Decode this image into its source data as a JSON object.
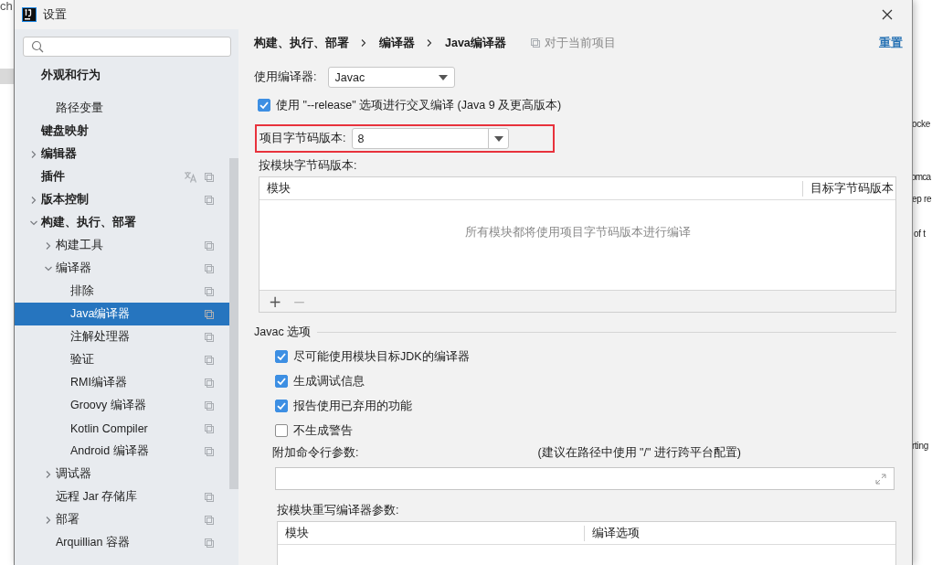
{
  "background_page": {
    "texts": [
      "ch",
      "ocke",
      "omca",
      "ep re",
      "of t",
      "rting"
    ]
  },
  "window": {
    "title": "设置"
  },
  "sidebar": {
    "items": [
      {
        "label": "外观和行为",
        "selected": false,
        "scope_icon": false,
        "children": [
          {
            "label": "路径变量",
            "selected": false,
            "scope_icon": false
          }
        ]
      },
      {
        "label": "键盘映射",
        "selected": false,
        "scope_icon": false
      },
      {
        "label": "编辑器",
        "selected": false,
        "expanded": false,
        "scope_icon": false
      },
      {
        "label": "插件",
        "selected": false,
        "scope_icon": true,
        "translate_icon": true
      },
      {
        "label": "版本控制",
        "selected": false,
        "expanded": false,
        "scope_icon": true
      },
      {
        "label": "构建、执行、部署",
        "selected": false,
        "expanded": true,
        "scope_icon": false,
        "children": [
          {
            "label": "构建工具",
            "selected": false,
            "expanded": false,
            "scope_icon": true
          },
          {
            "label": "编译器",
            "selected": false,
            "expanded": true,
            "scope_icon": true,
            "children": [
              {
                "label": "排除",
                "selected": false,
                "scope_icon": true
              },
              {
                "label": "Java编译器",
                "selected": true,
                "scope_icon": true
              },
              {
                "label": "注解处理器",
                "selected": false,
                "scope_icon": true
              },
              {
                "label": "验证",
                "selected": false,
                "scope_icon": true
              },
              {
                "label": "RMI编译器",
                "selected": false,
                "scope_icon": true
              },
              {
                "label": "Groovy 编译器",
                "selected": false,
                "scope_icon": true
              },
              {
                "label": "Kotlin Compiler",
                "selected": false,
                "scope_icon": true
              },
              {
                "label": "Android 编译器",
                "selected": false,
                "scope_icon": true
              }
            ]
          },
          {
            "label": "调试器",
            "selected": false,
            "expanded": false,
            "scope_icon": false
          },
          {
            "label": "远程 Jar 存储库",
            "selected": false,
            "scope_icon": true
          },
          {
            "label": "部署",
            "selected": false,
            "expanded": false,
            "scope_icon": true
          },
          {
            "label": "Arquillian 容器",
            "selected": false,
            "scope_icon": true
          }
        ]
      }
    ]
  },
  "breadcrumb": [
    "构建、执行、部署",
    "编译器",
    "Java编译器"
  ],
  "scope_note": "对于当前项目",
  "reset_link": "重置",
  "compiler": {
    "label": "使用编译器:",
    "value": "Javac"
  },
  "release_option": {
    "label": "使用 \"--release\" 选项进行交叉编译 (Java 9 及更高版本)",
    "checked": true
  },
  "bytecode_version": {
    "label": "项目字节码版本:",
    "value": "8",
    "highlighted": true
  },
  "per_module_table": {
    "title": "按模块字节码版本:",
    "columns": [
      "模块",
      "目标字节码版本"
    ],
    "empty_text": "所有模块都将使用项目字节码版本进行编译",
    "toolbar": [
      {
        "label": "+",
        "disabled": false
      },
      {
        "label": "−",
        "disabled": true
      }
    ]
  },
  "javac_options": {
    "title": "Javac 选项",
    "options": [
      {
        "label": "尽可能使用模块目标JDK的编译器",
        "checked": true
      },
      {
        "label": "生成调试信息",
        "checked": true
      },
      {
        "label": "报告使用已弃用的功能",
        "checked": true
      },
      {
        "label": "不生成警告",
        "checked": false
      }
    ],
    "extra_args": {
      "label": "附加命令行参数:",
      "hint": "(建议在路径中使用 \"/\" 进行跨平台配置)"
    },
    "override_table": {
      "title": "按模块重写编译器参数:",
      "columns": [
        "模块",
        "编译选项"
      ]
    }
  }
}
